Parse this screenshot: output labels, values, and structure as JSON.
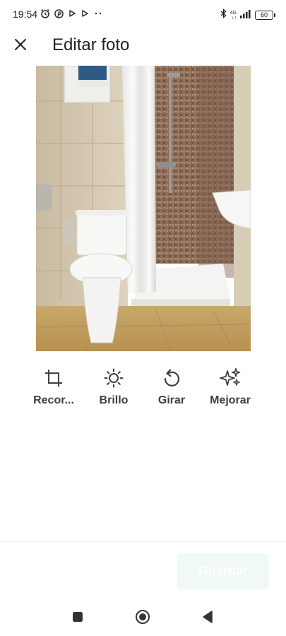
{
  "status_bar": {
    "time": "19:54",
    "network": "4G",
    "network_sub": "↓↑",
    "battery": "60",
    "icons": [
      "alarm-icon",
      "pinterest-icon",
      "play-icon",
      "play-icon",
      "more-dots-icon",
      "bluetooth-icon",
      "signal-icon",
      "battery-icon"
    ]
  },
  "header": {
    "title": "Editar foto",
    "close_icon": "close-icon"
  },
  "photo": {
    "subject": "bathroom-photo"
  },
  "tools": [
    {
      "label": "Recor...",
      "icon": "crop-icon"
    },
    {
      "label": "Brillo",
      "icon": "brightness-icon"
    },
    {
      "label": "Girar",
      "icon": "rotate-icon"
    },
    {
      "label": "Mejorar",
      "icon": "sparkle-icon"
    }
  ],
  "footer": {
    "save_label": "Guardar"
  },
  "nav": {
    "icons": [
      "recents-square-icon",
      "home-circle-icon",
      "back-triangle-icon"
    ]
  },
  "colors": {
    "title": "#202124",
    "tool_label": "#3c4043",
    "save_bg_disabled": "#f1f8f8"
  }
}
